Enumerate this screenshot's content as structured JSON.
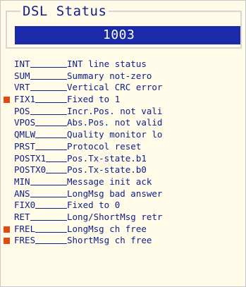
{
  "panel": {
    "title": "DSL Status",
    "value": "1003"
  },
  "colors": {
    "text": "#10208a",
    "value_background": "#1a2aa8",
    "panel_background": "#fffbe8",
    "active_marker": "#e04a14"
  },
  "rows": [
    {
      "code": "INT",
      "desc": "INT line status",
      "active": false
    },
    {
      "code": "SUM",
      "desc": "Summary not-zero",
      "active": false
    },
    {
      "code": "VRT",
      "desc": "Vertical CRC error",
      "active": false
    },
    {
      "code": "FIX1",
      "desc": "Fixed to 1",
      "active": true
    },
    {
      "code": "POS",
      "desc": "Incr.Pos. not vali",
      "active": false
    },
    {
      "code": "VPOS",
      "desc": "Abs.Pos. not valid",
      "active": false
    },
    {
      "code": "QMLW",
      "desc": "Quality monitor lo",
      "active": false
    },
    {
      "code": "PRST",
      "desc": "Protocol reset",
      "active": false
    },
    {
      "code": "POSTX1",
      "desc": "Pos.Tx-state.b1",
      "active": false
    },
    {
      "code": "POSTX0",
      "desc": "Pos.Tx-state.b0",
      "active": false
    },
    {
      "code": "MIN",
      "desc": "Message init ack",
      "active": false
    },
    {
      "code": "ANS",
      "desc": "LongMsg bad answer",
      "active": false
    },
    {
      "code": "FIX0",
      "desc": "Fixed to 0",
      "active": false
    },
    {
      "code": "RET",
      "desc": "Long/ShortMsg retr",
      "active": false
    },
    {
      "code": "FREL",
      "desc": "LongMsg ch free",
      "active": true
    },
    {
      "code": "FRES",
      "desc": "ShortMsg ch free",
      "active": true
    }
  ]
}
